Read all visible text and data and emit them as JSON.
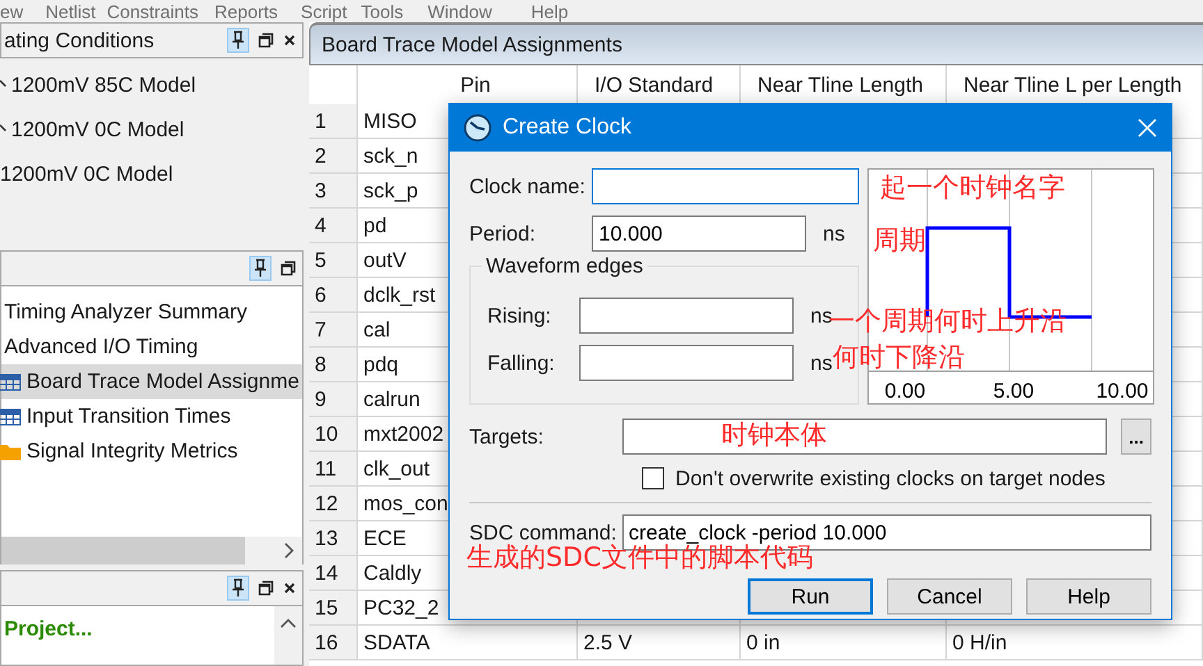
{
  "menu_bar": [
    "ew",
    "Netlist",
    "Constraints",
    "Reports",
    "Script",
    "Tools",
    "Window",
    "Help"
  ],
  "conditions_panel": {
    "title": "ating Conditions",
    "items": [
      {
        "label": "1200mV 85C Model",
        "kind": "expandable"
      },
      {
        "label": "1200mV 0C Model",
        "kind": "expandable"
      },
      {
        "label": "1200mV 0C Model",
        "kind": "leaf"
      }
    ]
  },
  "report_panel": {
    "items": [
      {
        "label": "Timing Analyzer Summary",
        "kind": "text",
        "selected": false
      },
      {
        "label": "Advanced I/O Timing",
        "kind": "text",
        "selected": false
      },
      {
        "label": "Board Trace Model Assignme",
        "kind": "table",
        "selected": true
      },
      {
        "label": "Input Transition Times",
        "kind": "table",
        "selected": false
      },
      {
        "label": "Signal Integrity Metrics",
        "kind": "folder",
        "selected": false
      }
    ]
  },
  "tasks_panel": {
    "items": [
      "Project..."
    ]
  },
  "table": {
    "title": "Board Trace Model Assignments",
    "columns": [
      "Pin",
      "I/O Standard",
      "Near Tline Length",
      "Near Tline L per Length"
    ],
    "rows": [
      {
        "index": "1",
        "cells": [
          "MISO"
        ]
      },
      {
        "index": "2",
        "cells": [
          "sck_n"
        ]
      },
      {
        "index": "3",
        "cells": [
          "sck_p"
        ]
      },
      {
        "index": "4",
        "cells": [
          "pd"
        ]
      },
      {
        "index": "5",
        "cells": [
          "outV"
        ]
      },
      {
        "index": "6",
        "cells": [
          "dclk_rst"
        ]
      },
      {
        "index": "7",
        "cells": [
          "cal"
        ]
      },
      {
        "index": "8",
        "cells": [
          "pdq"
        ]
      },
      {
        "index": "9",
        "cells": [
          "calrun"
        ]
      },
      {
        "index": "10",
        "cells": [
          "mxt2002"
        ]
      },
      {
        "index": "11",
        "cells": [
          "clk_out"
        ]
      },
      {
        "index": "12",
        "cells": [
          "mos_con"
        ]
      },
      {
        "index": "13",
        "cells": [
          "ECE"
        ]
      },
      {
        "index": "14",
        "cells": [
          "Caldly"
        ]
      },
      {
        "index": "15",
        "cells": [
          "PC32_2"
        ]
      },
      {
        "index": "16",
        "cells": [
          "SDATA",
          "2.5 V",
          "0 in",
          "0 H/in"
        ]
      }
    ]
  },
  "dialog": {
    "title": "Create Clock",
    "clock_name": {
      "label": "Clock name:",
      "focused": true
    },
    "period": {
      "label": "Period:",
      "value": "10.000",
      "unit": "ns",
      "focused": false
    },
    "waveform_edges": {
      "title": "Waveform edges",
      "rising": {
        "label": "Rising:",
        "unit": "ns",
        "focused": false
      },
      "falling": {
        "label": "Falling:",
        "unit": "ns",
        "focused": false
      }
    },
    "waveform_preview": {
      "tick_labels": [
        "0.00",
        "5.00",
        "10.00"
      ]
    },
    "targets": {
      "label": "Targets:",
      "browse": "...",
      "focused": false
    },
    "dont_overwrite": {
      "label": "Don't overwrite existing clocks on target nodes",
      "checked": false
    },
    "sdc_command": {
      "label": "SDC command:",
      "value": "create_clock -period 10.000",
      "focused": false
    },
    "buttons": [
      {
        "label": "Run",
        "default": true
      },
      {
        "label": "Cancel",
        "default": false
      },
      {
        "label": "Help",
        "default": false
      }
    ]
  },
  "annotations": [
    {
      "text": "起一个时钟名字"
    },
    {
      "text": "周期"
    },
    {
      "text": "一个周期何时上升沿"
    },
    {
      "text": "何时下降沿"
    },
    {
      "text": "时钟本体"
    },
    {
      "text": "生成的SDC文件中的脚本代码"
    }
  ]
}
